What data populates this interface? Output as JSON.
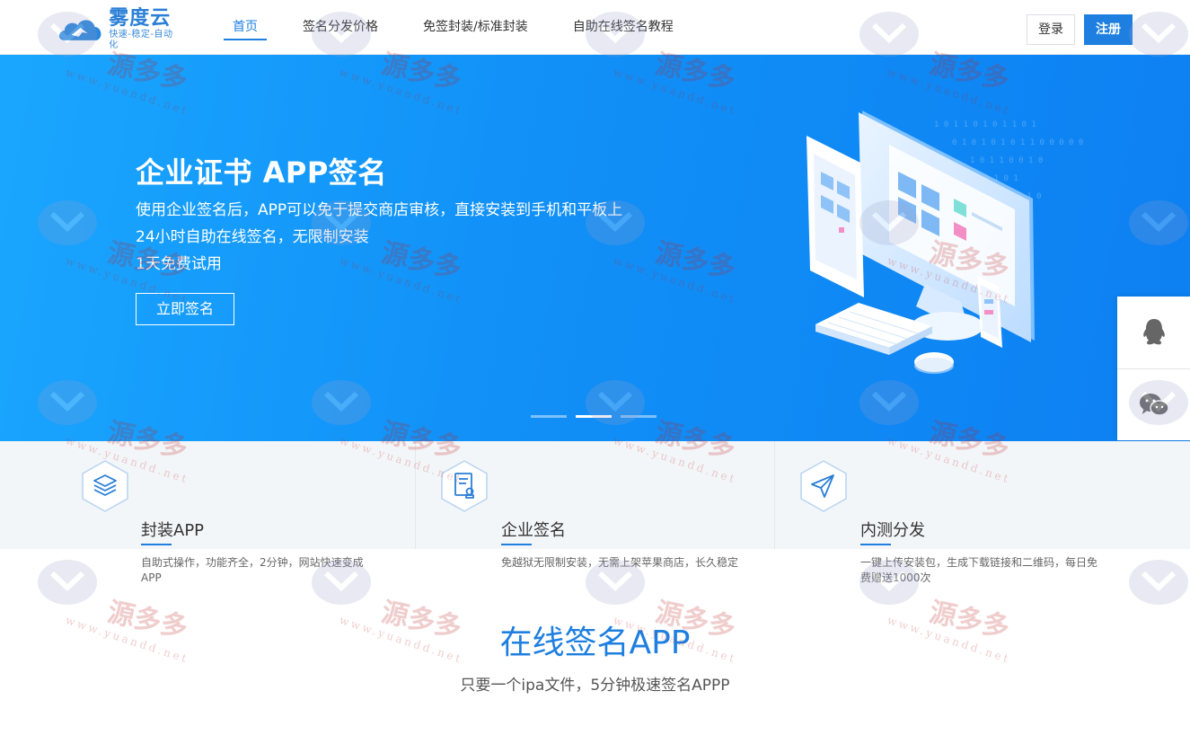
{
  "header": {
    "logo": {
      "name": "雾度云",
      "slogan": "快速-稳定-自动化"
    },
    "nav": [
      {
        "label": "首页",
        "active": true
      },
      {
        "label": "签名分发价格",
        "active": false
      },
      {
        "label": "免签封装/标准封装",
        "active": false
      },
      {
        "label": "自助在线签名教程",
        "active": false
      }
    ],
    "login_label": "登录",
    "register_label": "注册"
  },
  "banner": {
    "title": "企业证书 APP签名",
    "lines": [
      "使用企业签名后，APP可以免于提交商店审核，直接安装到手机和平板上",
      "24小时自助在线签名，无限制安装",
      "1天免费试用"
    ],
    "button_label": "立即签名",
    "slides": [
      {
        "active": false
      },
      {
        "active": true
      },
      {
        "active": false
      }
    ]
  },
  "side_float": {
    "items": [
      {
        "icon": "qq-icon"
      },
      {
        "icon": "wechat-icon"
      }
    ]
  },
  "features": [
    {
      "icon": "layers-icon",
      "title": "封装APP",
      "desc": "自助式操作，功能齐全，2分钟，网站快速变成APP"
    },
    {
      "icon": "certificate-icon",
      "title": "企业签名",
      "desc": "免越狱无限制安装，无需上架苹果商店，长久稳定"
    },
    {
      "icon": "paper-plane-icon",
      "title": "内测分发",
      "desc": "一键上传安装包，生成下载链接和二维码，每日免费赠送1000次"
    }
  ],
  "section": {
    "title": "在线签名APP",
    "subtitle": "只要一个ipa文件，5分钟极速签名APPP"
  },
  "watermark": {
    "text": "源多多",
    "url": "www.yuandd.net"
  },
  "colors": {
    "accent": "#1e7fe0",
    "banner_start": "#1aa6ff",
    "banner_end": "#0d80f2",
    "feature_bg": "#f3f6f9"
  }
}
